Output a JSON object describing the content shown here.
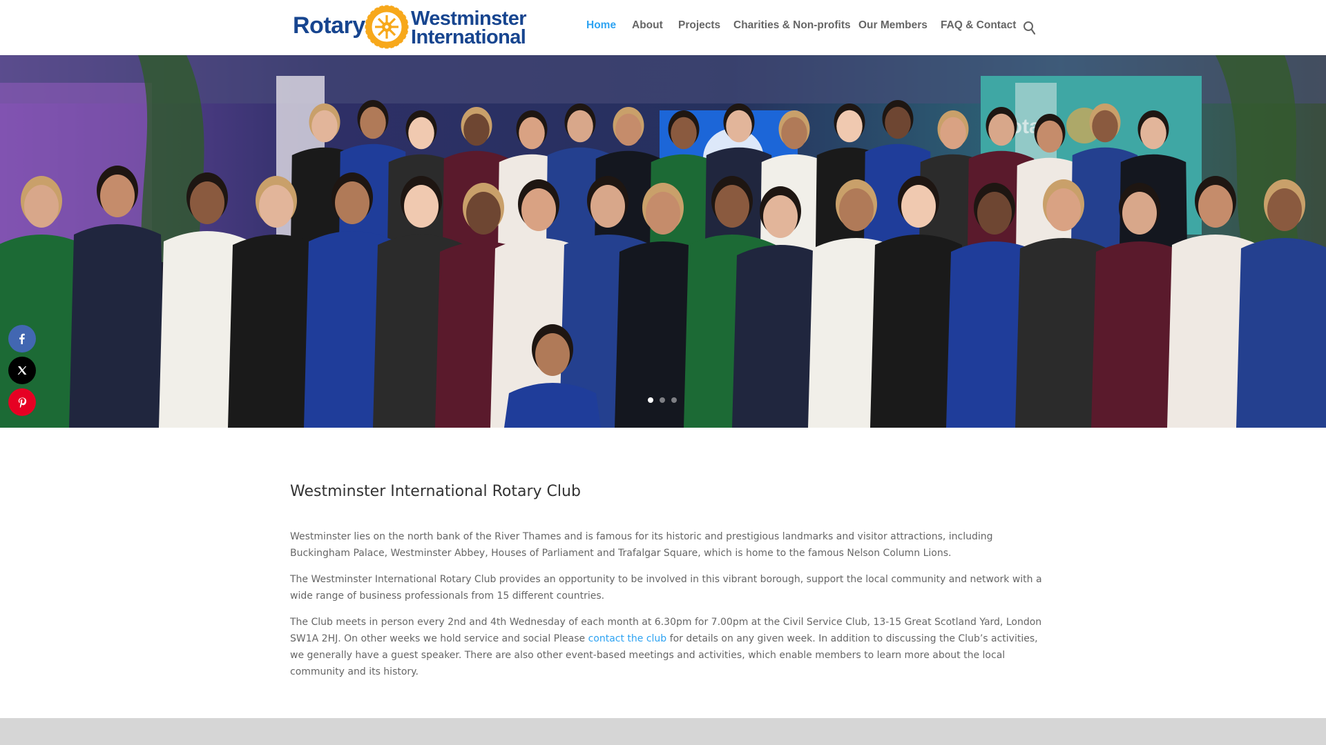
{
  "brand": {
    "logo_word_rotary": "Rotary",
    "logo_word_westminster": "Westminster",
    "logo_word_international": "International",
    "logo_alt": "Rotary Westminster International",
    "colors": {
      "rotary_blue": "#17458f",
      "rotary_gold": "#f7a81b"
    }
  },
  "nav": {
    "items": [
      {
        "label": "Home",
        "active": true
      },
      {
        "label": "About"
      },
      {
        "label": "Projects"
      },
      {
        "label": "Charities & Non-profits"
      },
      {
        "label": "Our Members"
      },
      {
        "label": "FAQ & Contact"
      }
    ],
    "search_icon": "search-icon",
    "active_color": "#2ea3f2",
    "text_color": "#666666"
  },
  "hero": {
    "image_description_icon": "group-photo",
    "slider": {
      "count": 3,
      "active_index": 0
    }
  },
  "share": {
    "buttons": [
      {
        "icon": "facebook-icon",
        "color": "#4267b2"
      },
      {
        "icon": "x-icon",
        "color": "#000000"
      },
      {
        "icon": "pinterest-icon",
        "color": "#e60023"
      }
    ]
  },
  "content": {
    "title": "Westminster International Rotary Club",
    "p1": "Westminster lies on the north bank of the River Thames and is famous for its historic and prestigious landmarks and visitor attractions, including Buckingham Palace, Westminster Abbey, Houses of Parliament and Trafalgar Square, which is home to the famous Nelson Column Lions.",
    "p2": "The Westminster International Rotary Club provides an opportunity to be involved in this vibrant borough, support the local community and network with a wide range of business professionals from 15 different countries.",
    "p3_before_link": "The Club meets in person every 2nd and 4th Wednesday of each month at 6.30pm for 7.00pm at the Civil Service Club, 13-15 Great Scotland Yard, London SW1A 2HJ. On other weeks we hold service and social Please ",
    "p3_link": "contact the club",
    "p3_after_link": " for details on any given week. In addition to discussing the Club’s activities, we generally have a guest speaker. There are also other event-based meetings and activities, which enable members to learn more about the local community and its history."
  }
}
